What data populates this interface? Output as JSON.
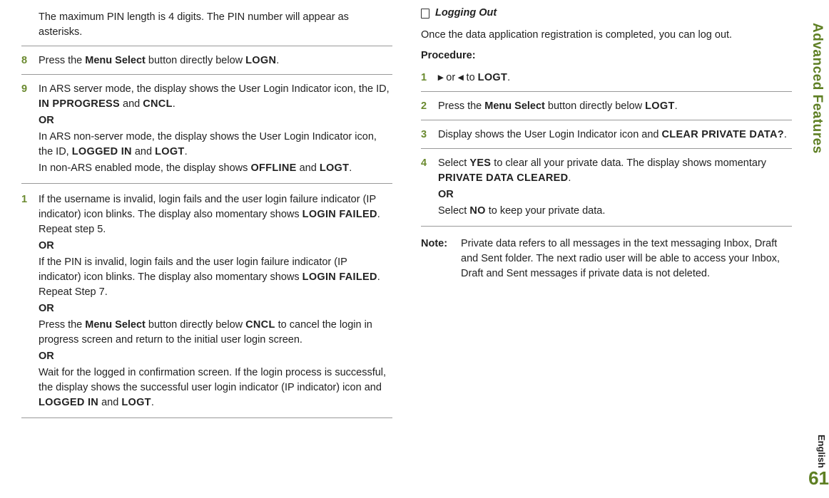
{
  "side_tab": "Advanced Features",
  "lang": "English",
  "page_number": "61",
  "left": {
    "intro": "The maximum PIN length is 4 digits. The PIN number will appear as asterisks.",
    "step8_num": "8",
    "step8_a": "Press the ",
    "step8_menu": "Menu Select",
    "step8_b": " button directly below ",
    "step8_logn": "LOGN",
    "step8_c": ".",
    "step9_num": "9",
    "step9_l1a": "In ARS server mode, the display shows the User Login Indicator icon, the ID, ",
    "step9_inprog": "IN PPROGRESS",
    "step9_l1b": " and ",
    "step9_cncl": "CNCL",
    "step9_l1c": ".",
    "or1": "OR",
    "step9_l2a": "In ARS non-server mode, the display shows the User Login Indicator icon, the ID, ",
    "step9_loggedin": "LOGGED IN",
    "step9_l2b": " and ",
    "step9_logt": "LOGT",
    "step9_l2c": ".",
    "step9_l3a": "In non-ARS enabled mode, the display shows ",
    "step9_offline": "OFFLINE",
    "step9_l3b": " and ",
    "step9_logt2": "LOGT",
    "step9_l3c": ".",
    "step1_num": "1",
    "step1_p1a": "If the username is invalid, login fails and the user login failure indicator (IP indicator) icon blinks. The display also momentary shows ",
    "step1_loginfailed": "LOGIN FAILED",
    "step1_p1b": ". Repeat step 5.",
    "or2": "OR",
    "step1_p2a": "If the PIN is invalid, login fails and the user login failure indicator (IP indicator) icon blinks. The display also momentary shows ",
    "step1_loginfailed2": "LOGIN FAILED",
    "step1_p2b": ". Repeat Step 7.",
    "or3": "OR",
    "step1_p3a": "Press the ",
    "step1_menu": "Menu Select",
    "step1_p3b": " button directly below ",
    "step1_cncl": "CNCL",
    "step1_p3c": " to cancel the login in progress screen and return to the initial user login screen.",
    "or4": "OR",
    "step1_p4a": "Wait for the logged in confirmation screen. If the login process is successful, the display shows the successful user login indicator (IP indicator) icon and ",
    "step1_loggedin": "LOGGED IN",
    "step1_p4b": " and ",
    "step1_logt": "LOGT",
    "step1_p4c": "."
  },
  "right": {
    "section_title": "Logging Out",
    "intro": "Once the data application registration is completed, you can log out.",
    "procedure": "Procedure:",
    "s1_num": "1",
    "s1_a": " or ",
    "s1_b": " to ",
    "s1_logt": "LOGT",
    "s1_c": ".",
    "s2_num": "2",
    "s2_a": "Press the ",
    "s2_menu": "Menu Select",
    "s2_b": " button directly below ",
    "s2_logt": "LOGT",
    "s2_c": ".",
    "s3_num": "3",
    "s3_a": "Display shows the User Login Indicator icon and ",
    "s3_clear": "CLEAR PRIVATE DATA?",
    "s3_b": ".",
    "s4_num": "4",
    "s4_a": "Select ",
    "s4_yes": "YES",
    "s4_b": " to clear all your private data. The display shows momentary ",
    "s4_cleared": "PRIVATE DATA CLEARED",
    "s4_c": ".",
    "or": "OR",
    "s4_d": "Select ",
    "s4_no": "NO",
    "s4_e": " to keep your private data.",
    "note_label": "Note:",
    "note_body": "Private data refers to all messages in the text messaging Inbox, Draft and Sent folder. The next radio user will be able to access your Inbox, Draft and Sent messages if private data is not deleted."
  }
}
